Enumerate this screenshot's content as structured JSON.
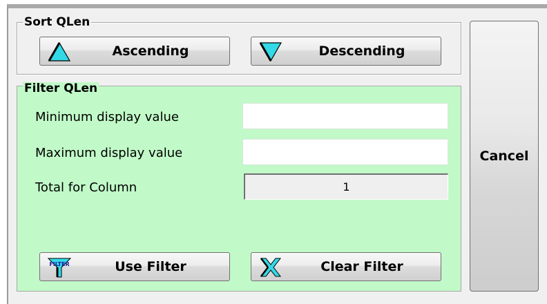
{
  "sort": {
    "group_title": "Sort QLen",
    "ascending_label": "Ascending",
    "descending_label": "Descending"
  },
  "filter": {
    "group_title": "Filter QLen",
    "min_label": "Minimum display value",
    "min_value": "",
    "max_label": "Maximum display value",
    "max_value": "",
    "total_label": "Total for Column",
    "total_value": "1",
    "use_filter_label": "Use Filter",
    "filter_icon_text": "FILTER",
    "clear_filter_label": "Clear Filter"
  },
  "cancel_label": "Cancel",
  "colors": {
    "filter_background": "#c1fac8",
    "arrow_cyan": "#33d9e6",
    "window_background": "#f0f0f0"
  }
}
